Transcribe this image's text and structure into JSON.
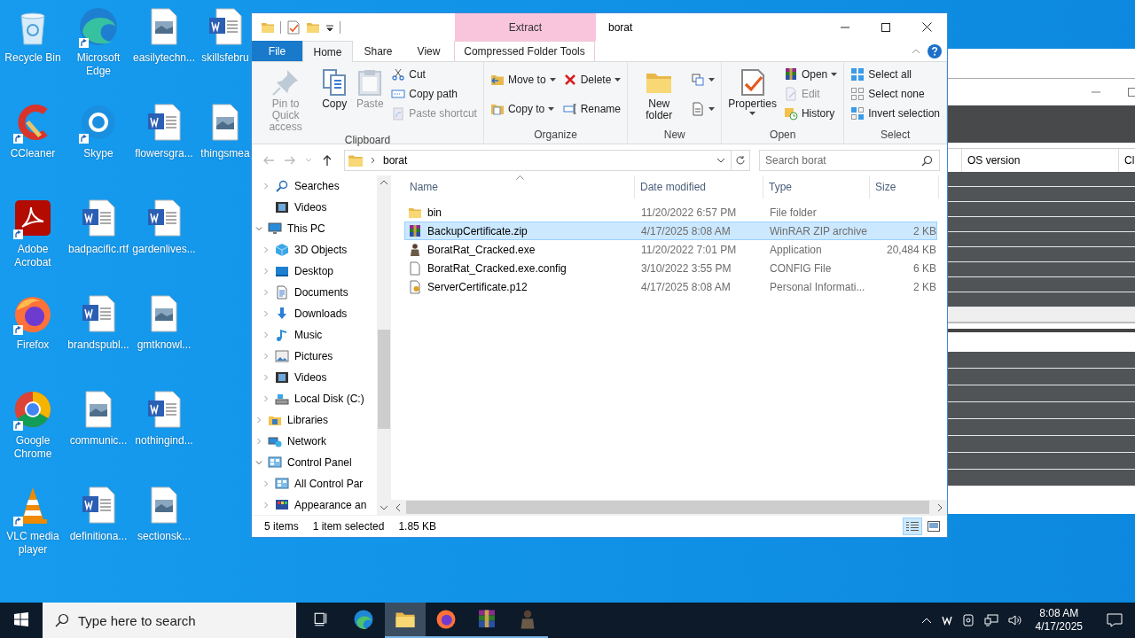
{
  "desktop_icons": [
    {
      "label": "Recycle Bin",
      "kind": "recycle",
      "shortcut": false
    },
    {
      "label": "CCleaner",
      "kind": "ccleaner",
      "shortcut": true
    },
    {
      "label": "Adobe Acrobat",
      "kind": "acrobat",
      "shortcut": true
    },
    {
      "label": "Firefox",
      "kind": "firefox",
      "shortcut": true
    },
    {
      "label": "Google Chrome",
      "kind": "chrome",
      "shortcut": true
    },
    {
      "label": "VLC media player",
      "kind": "vlc",
      "shortcut": true
    },
    {
      "label": "Microsoft Edge",
      "kind": "edge",
      "shortcut": true
    },
    {
      "label": "Skype",
      "kind": "skype",
      "shortcut": true
    },
    {
      "label": "badpacific.rtf",
      "kind": "word",
      "shortcut": false
    },
    {
      "label": "brandspubl...",
      "kind": "word",
      "shortcut": false
    },
    {
      "label": "communic...",
      "kind": "image",
      "shortcut": false
    },
    {
      "label": "definitiona...",
      "kind": "word",
      "shortcut": false
    },
    {
      "label": "easilytechn...",
      "kind": "image",
      "shortcut": false
    },
    {
      "label": "flowersgra...",
      "kind": "word",
      "shortcut": false
    },
    {
      "label": "gardenlives...",
      "kind": "word",
      "shortcut": false
    },
    {
      "label": "gmtknowl...",
      "kind": "image",
      "shortcut": false
    },
    {
      "label": "nothingind...",
      "kind": "word",
      "shortcut": false
    },
    {
      "label": "sectionsk...",
      "kind": "image",
      "shortcut": false
    },
    {
      "label": "skillsfebru",
      "kind": "word",
      "shortcut": false
    },
    {
      "label": "thingsmea",
      "kind": "image",
      "shortcut": false
    }
  ],
  "explorer": {
    "title": "borat",
    "contextual_header": "Extract",
    "tabs": [
      {
        "label": "File",
        "kind": "file",
        "selected": false
      },
      {
        "label": "Home",
        "kind": "normal",
        "selected": true
      },
      {
        "label": "Share",
        "kind": "normal",
        "selected": false
      },
      {
        "label": "View",
        "kind": "normal",
        "selected": false
      },
      {
        "label": "Compressed Folder Tools",
        "kind": "contextual",
        "selected": false
      }
    ],
    "ribbon": [
      {
        "label": "Clipboard",
        "columns": [
          [
            {
              "label": "Pin to Quick access",
              "kind": "large",
              "dropdown": false,
              "disabled": true
            }
          ],
          [
            {
              "label": "Copy",
              "kind": "large",
              "dropdown": false,
              "disabled": false
            }
          ],
          [
            {
              "label": "Paste",
              "kind": "large",
              "dropdown": false,
              "disabled": true
            }
          ],
          [
            {
              "label": "Cut",
              "kind": "small",
              "dropdown": false,
              "disabled": false
            },
            {
              "label": "Copy path",
              "kind": "small",
              "dropdown": false,
              "disabled": false
            },
            {
              "label": "Paste shortcut",
              "kind": "small",
              "dropdown": false,
              "disabled": true
            }
          ]
        ]
      },
      {
        "label": "Organize",
        "columns": [
          [
            {
              "label": "Move to",
              "kind": "small",
              "dropdown": true,
              "disabled": false
            },
            {
              "label": "Copy to",
              "kind": "small",
              "dropdown": true,
              "disabled": false
            }
          ],
          [
            {
              "label": "Delete",
              "kind": "small",
              "dropdown": true,
              "disabled": false
            },
            {
              "label": "Rename",
              "kind": "small",
              "dropdown": false,
              "disabled": false
            }
          ]
        ]
      },
      {
        "label": "New",
        "columns": [
          [
            {
              "label": "New folder",
              "kind": "large",
              "dropdown": false,
              "disabled": false
            }
          ],
          [
            {
              "kind": "icon",
              "dropdown": true,
              "disabled": false
            },
            {
              "kind": "icon",
              "dropdown": true,
              "disabled": false
            }
          ]
        ]
      },
      {
        "label": "Open",
        "columns": [
          [
            {
              "label": "Properties",
              "kind": "large",
              "dropdown": true,
              "disabled": false
            }
          ],
          [
            {
              "label": "Open",
              "kind": "small",
              "dropdown": true,
              "disabled": false
            },
            {
              "label": "Edit",
              "kind": "small",
              "dropdown": false,
              "disabled": true
            },
            {
              "label": "History",
              "kind": "small",
              "dropdown": false,
              "disabled": false
            }
          ]
        ]
      },
      {
        "label": "Select",
        "columns": [
          [
            {
              "label": "Select all",
              "kind": "small",
              "dropdown": false,
              "disabled": false
            },
            {
              "label": "Select none",
              "kind": "small",
              "dropdown": false,
              "disabled": false
            },
            {
              "label": "Invert selection",
              "kind": "small",
              "dropdown": false,
              "disabled": false
            }
          ]
        ]
      }
    ],
    "address": {
      "path": "borat",
      "search_placeholder": "Search borat"
    },
    "nav": [
      {
        "children": [
          {
            "label": "Searches",
            "kind": "search",
            "expandable": true,
            "expanded": false
          },
          {
            "label": "Videos",
            "kind": "video",
            "expandable": false
          }
        ]
      },
      {
        "label": "This PC",
        "kind": "pc",
        "expandable": true,
        "expanded": true,
        "children": [
          {
            "label": "3D Objects",
            "kind": "cube",
            "expandable": true,
            "expanded": false
          },
          {
            "label": "Desktop",
            "kind": "desktop",
            "expandable": true,
            "expanded": false
          },
          {
            "label": "Documents",
            "kind": "docs",
            "expandable": true,
            "expanded": false
          },
          {
            "label": "Downloads",
            "kind": "download",
            "expandable": true,
            "expanded": false
          },
          {
            "label": "Music",
            "kind": "music",
            "expandable": true,
            "expanded": false
          },
          {
            "label": "Pictures",
            "kind": "pictures",
            "expandable": true,
            "expanded": false
          },
          {
            "label": "Videos",
            "kind": "video",
            "expandable": true,
            "expanded": false
          },
          {
            "label": "Local Disk (C:)",
            "kind": "disk",
            "expandable": true,
            "expanded": false
          }
        ]
      },
      {
        "label": "Libraries",
        "kind": "library",
        "expandable": true,
        "expanded": false
      },
      {
        "label": "Network",
        "kind": "network",
        "expandable": true,
        "expanded": false
      },
      {
        "label": "Control Panel",
        "kind": "control",
        "expandable": true,
        "expanded": true,
        "children": [
          {
            "label": "All Control Par",
            "kind": "control",
            "expandable": true,
            "expanded": false
          },
          {
            "label": "Appearance an",
            "kind": "appearance",
            "expandable": true,
            "expanded": false
          }
        ]
      }
    ],
    "columns": [
      {
        "label": "Name",
        "sorted": true
      },
      {
        "label": "Date modified",
        "sorted": false
      },
      {
        "label": "Type",
        "sorted": false
      },
      {
        "label": "Size",
        "sorted": false
      }
    ],
    "files": [
      {
        "name": "bin",
        "date": "11/20/2022 6:57 PM",
        "type": "File folder",
        "kind": "folder",
        "selected": false
      },
      {
        "name": "BackupCertificate.zip",
        "date": "4/17/2025 8:08 AM",
        "type": "WinRAR ZIP archive",
        "size": "2 KB",
        "kind": "zip",
        "selected": true
      },
      {
        "name": "BoratRat_Cracked.exe",
        "date": "11/20/2022 7:01 PM",
        "type": "Application",
        "size": "20,484 KB",
        "kind": "figure",
        "selected": false
      },
      {
        "name": "BoratRat_Cracked.exe.config",
        "date": "3/10/2022 3:55 PM",
        "type": "CONFIG File",
        "size": "6 KB",
        "kind": "file",
        "selected": false
      },
      {
        "name": "ServerCertificate.p12",
        "date": "4/17/2025 8:08 AM",
        "type": "Personal Informati...",
        "size": "2 KB",
        "kind": "cert",
        "selected": false
      }
    ],
    "status": {
      "count": "5 items",
      "selection": "1 item selected",
      "size": "1.85 KB"
    },
    "views": [
      {
        "kind": "details",
        "selected": true
      },
      {
        "kind": "large",
        "selected": false
      }
    ]
  },
  "background_window": {
    "columns": [
      "OS version",
      "Cl"
    ]
  },
  "taskbar": {
    "search_placeholder": "Type here to search",
    "apps": [
      {
        "kind": "taskview",
        "running": false,
        "selected": false
      },
      {
        "kind": "edge",
        "running": false,
        "selected": false
      },
      {
        "kind": "folder",
        "running": true,
        "selected": true
      },
      {
        "kind": "firefox",
        "running": true,
        "selected": false
      },
      {
        "kind": "zip",
        "running": true,
        "selected": false
      },
      {
        "kind": "figure",
        "running": true,
        "selected": false
      }
    ],
    "time": "8:08 AM",
    "date": "4/17/2025"
  }
}
